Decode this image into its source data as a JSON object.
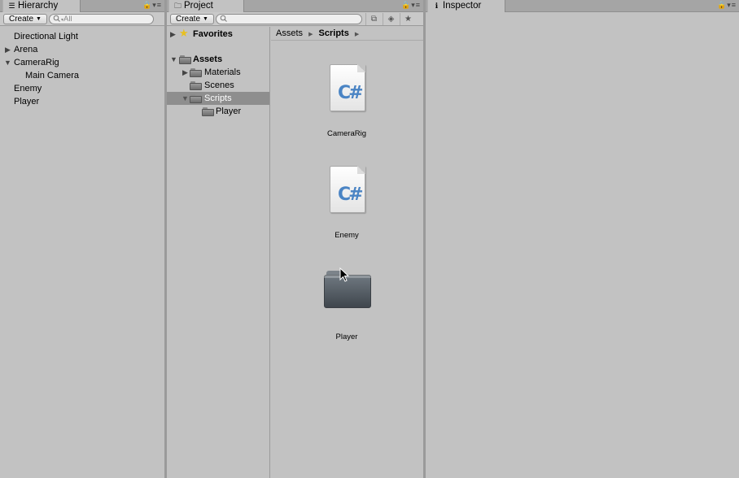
{
  "hierarchy": {
    "tab_label": "Hierarchy",
    "create_label": "Create",
    "search_placeholder": "All",
    "items": [
      {
        "label": "Directional Light",
        "expander": ""
      },
      {
        "label": "Arena",
        "expander": "collapsed"
      },
      {
        "label": "CameraRig",
        "expander": "expanded"
      },
      {
        "label": "Main Camera",
        "expander": ""
      },
      {
        "label": "Enemy",
        "expander": ""
      },
      {
        "label": "Player",
        "expander": ""
      }
    ]
  },
  "project": {
    "tab_label": "Project",
    "create_label": "Create",
    "search_placeholder": "",
    "favorites_label": "Favorites",
    "assets_label": "Assets",
    "folders": [
      {
        "label": "Materials"
      },
      {
        "label": "Scenes"
      },
      {
        "label": "Scripts"
      },
      {
        "label": "Player"
      }
    ],
    "breadcrumb": {
      "root": "Assets",
      "current": "Scripts"
    },
    "assets": [
      {
        "name": "CameraRig",
        "icon": "csharp-script-icon"
      },
      {
        "name": "Enemy",
        "icon": "csharp-script-icon"
      },
      {
        "name": "Player",
        "icon": "folder-icon"
      }
    ]
  },
  "inspector": {
    "tab_label": "Inspector"
  },
  "colors": {
    "panel_bg": "#c2c2c2",
    "selection": "#8e8e8e",
    "csharp_blue": "#4a84c4"
  }
}
